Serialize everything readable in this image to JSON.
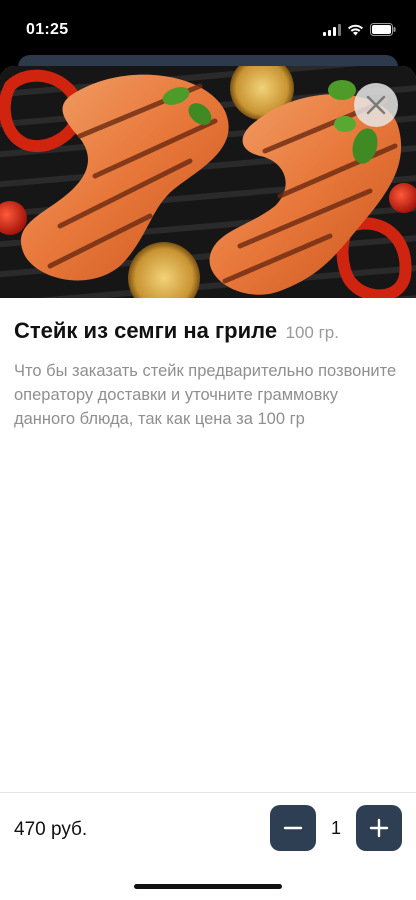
{
  "status_bar": {
    "time": "01:25"
  },
  "dish": {
    "title": "Стейк из семги на гриле",
    "weight": "100 гр.",
    "description": "Что бы заказать стейк предварительно позвоните оператору доставки и уточните граммовку данного блюда, так как цена за 100 гр"
  },
  "footer": {
    "price": "470 руб.",
    "quantity": "1"
  },
  "colors": {
    "accent": "#2f3f53",
    "muted_text": "#8f8f8f"
  },
  "icons": {
    "close": "close-icon",
    "minus": "minus-icon",
    "plus": "plus-icon"
  }
}
